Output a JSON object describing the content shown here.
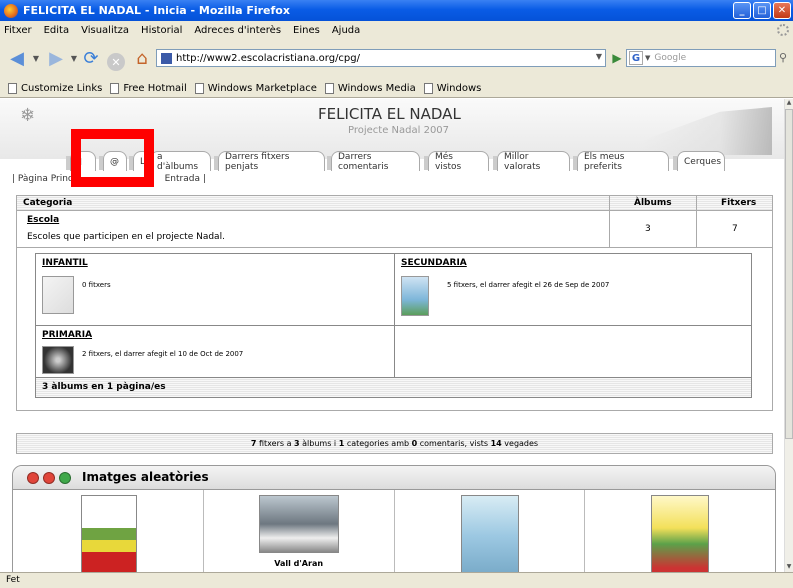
{
  "window": {
    "title": "FELICITA EL NADAL - Inicia - Mozilla Firefox",
    "minimize": "_",
    "maximize": "□",
    "close": "✕"
  },
  "menu": [
    "Fitxer",
    "Edita",
    "Visualitza",
    "Historial",
    "Adreces d'interès",
    "Eines",
    "Ajuda"
  ],
  "nav": {
    "url": "http://www2.escolacristiana.org/cpg/",
    "search_placeholder": "Google",
    "icons": [
      "back-icon",
      "forward-icon",
      "reload-icon",
      "stop-icon",
      "home-icon",
      "go-icon",
      "magnifier-icon"
    ]
  },
  "bookmarks": [
    "Customize Links",
    "Free Hotmail",
    "Windows Marketplace",
    "Windows Media",
    "Windows"
  ],
  "site": {
    "title": "FELICITA EL NADAL",
    "subtitle": "Projecte Nadal 2007"
  },
  "tabs": [
    "",
    "@",
    "L",
    "a d'àlbums",
    "Darrers fitxers penjats",
    "Darrers comentaris",
    "Més vistos",
    "Millor valorats",
    "Els meus preferits",
    "Cerques"
  ],
  "crumbs": {
    "left": "| Pàgina Princ",
    "right": "Entrada |"
  },
  "table": {
    "headers": {
      "category": "Categoria",
      "albums": "Àlbums",
      "files": "Fitxers"
    },
    "category": {
      "name": "Escola",
      "description": "Escoles que participen en el projecte Nadal.",
      "albums": "3",
      "files": "7"
    },
    "subalbums": [
      {
        "name": "INFANTIL",
        "info": "0 fitxers"
      },
      {
        "name": "SECUNDARIA",
        "info": "5 fitxers, el darrer afegit el 26 de Sep de 2007"
      },
      {
        "name": "PRIMARIA",
        "info": "2 fitxers, el darrer afegit el 10 de Oct de 2007"
      }
    ],
    "footer": "3 àlbums en 1 pàgina/es"
  },
  "stats": {
    "files": "7",
    "t1": " fitxers a ",
    "albums": "3",
    "t2": " àlbums i ",
    "categories": "1",
    "t3": " categories amb ",
    "comments": "0",
    "t4": " comentaris, vists ",
    "views": "14",
    "t5": " vegades"
  },
  "random": {
    "title": "Imatges aleatòries",
    "captions": [
      "",
      "Vall d'Aran",
      "",
      ""
    ],
    "dot_colors": [
      "#e0453a",
      "#e0453a",
      "#3fa84a"
    ]
  },
  "status": "Fet"
}
